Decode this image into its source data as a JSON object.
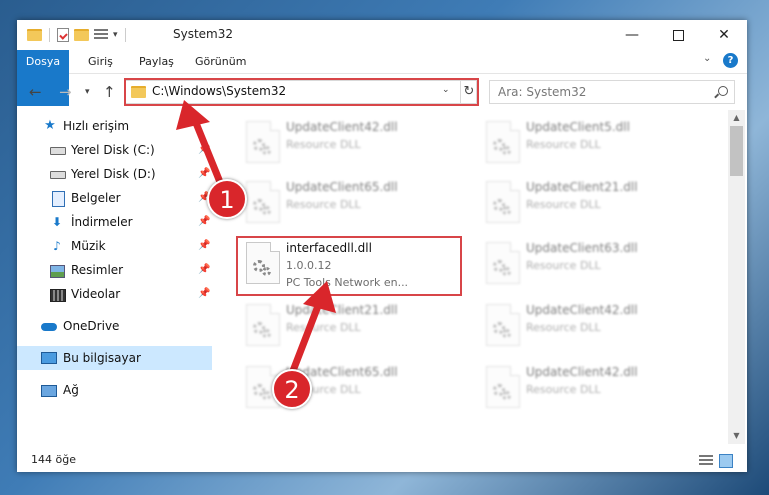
{
  "window": {
    "title": "System32"
  },
  "ribbon": {
    "tabs": [
      "Dosya",
      "Giriş",
      "Paylaş",
      "Görünüm"
    ],
    "help": "?"
  },
  "address": {
    "path": "C:\\Windows\\System32"
  },
  "search": {
    "placeholder": "Ara: System32"
  },
  "sidebar": {
    "items": [
      {
        "label": "Hızlı erişim",
        "icon": "star-icon",
        "pinned": false
      },
      {
        "label": "Yerel Disk (C:)",
        "icon": "drive-icon",
        "pinned": true
      },
      {
        "label": "Yerel Disk (D:)",
        "icon": "drive-icon",
        "pinned": true
      },
      {
        "label": "Belgeler",
        "icon": "documents-icon",
        "pinned": true
      },
      {
        "label": "İndirmeler",
        "icon": "download-icon",
        "pinned": true
      },
      {
        "label": "Müzik",
        "icon": "music-icon",
        "pinned": true
      },
      {
        "label": "Resimler",
        "icon": "pictures-icon",
        "pinned": true
      },
      {
        "label": "Videolar",
        "icon": "videos-icon",
        "pinned": true
      },
      {
        "label": "OneDrive",
        "icon": "cloud-icon",
        "pinned": false
      },
      {
        "label": "Bu bilgisayar",
        "icon": "computer-icon",
        "pinned": false,
        "selected": true
      },
      {
        "label": "Ağ",
        "icon": "network-icon",
        "pinned": false
      }
    ]
  },
  "files": [
    {
      "name": "UpdateClient42.dll",
      "line2": "Resource DLL",
      "line3": "",
      "blurred": true
    },
    {
      "name": "UpdateClient5.dll",
      "line2": "Resource DLL",
      "line3": "",
      "blurred": true
    },
    {
      "name": "UpdateClient65.dll",
      "line2": "Resource DLL",
      "line3": "",
      "blurred": true
    },
    {
      "name": "UpdateClient21.dll",
      "line2": "Resource DLL",
      "line3": "",
      "blurred": true
    },
    {
      "name": "interfacedll.dll",
      "line2": "1.0.0.12",
      "line3": "PC Tools Network en...",
      "blurred": false
    },
    {
      "name": "UpdateClient63.dll",
      "line2": "Resource DLL",
      "line3": "",
      "blurred": true
    },
    {
      "name": "UpdateClient21.dll",
      "line2": "Resource DLL",
      "line3": "",
      "blurred": true
    },
    {
      "name": "UpdateClient42.dll",
      "line2": "Resource DLL",
      "line3": "",
      "blurred": true
    },
    {
      "name": "UpdateClient65.dll",
      "line2": "Resource DLL",
      "line3": "",
      "blurred": true
    },
    {
      "name": "UpdateClient42.dll",
      "line2": "Resource DLL",
      "line3": "",
      "blurred": true
    }
  ],
  "status": {
    "count": "144 öğe"
  },
  "annotations": {
    "badge1": "1",
    "badge2": "2",
    "color": "#d9262b"
  },
  "colors": {
    "accent": "#1979ca",
    "selection": "#cce8ff",
    "highlight": "#d84548"
  }
}
